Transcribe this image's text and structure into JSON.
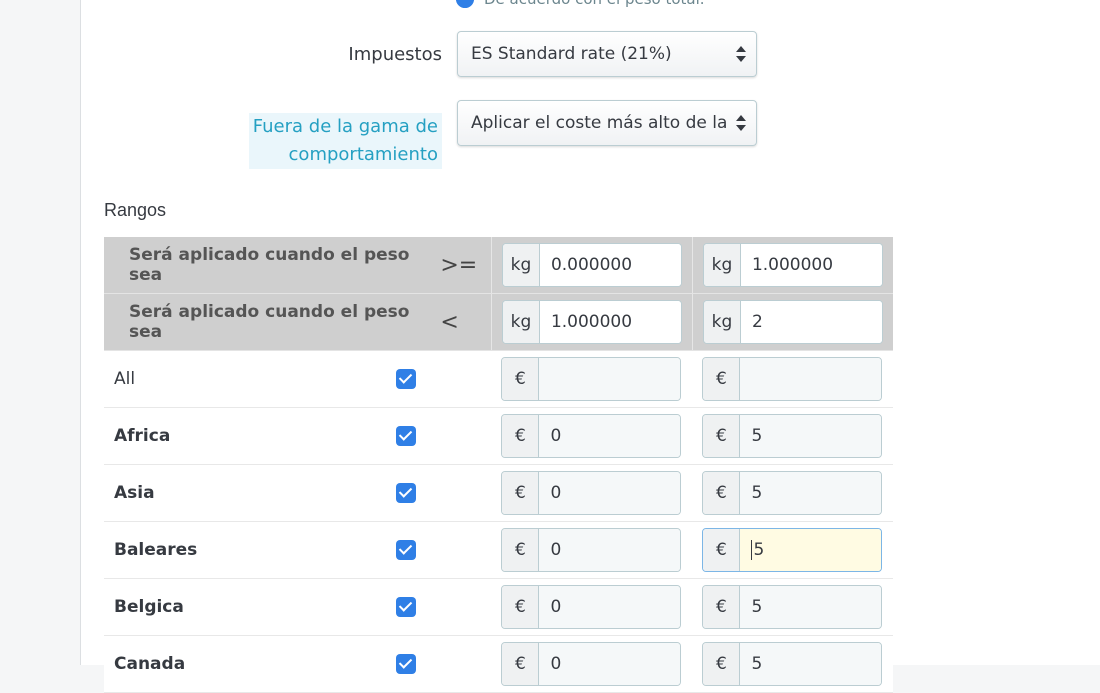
{
  "billing": {
    "option_label": "De acuerdo con el peso total."
  },
  "tax": {
    "label": "Impuestos",
    "selected": "ES Standard rate (21%)"
  },
  "out_of_range": {
    "label_line1": "Fuera de la gama de",
    "label_line2": "comportamiento",
    "selected": "Aplicar el coste más alto de la"
  },
  "ranges": {
    "title": "Rangos",
    "header_rows": [
      {
        "label": "Será aplicado cuando el peso sea",
        "operator": ">=",
        "unit": "kg",
        "values": [
          "0.000000",
          "1.000000"
        ]
      },
      {
        "label": "Será aplicado cuando el peso sea",
        "operator": "<",
        "unit": "kg",
        "values": [
          "1.000000",
          "2"
        ]
      }
    ],
    "currency": "€",
    "zones": [
      {
        "name": "All",
        "bold": false,
        "checked": true,
        "values": [
          "",
          ""
        ]
      },
      {
        "name": "Africa",
        "bold": true,
        "checked": true,
        "values": [
          "0",
          "5"
        ]
      },
      {
        "name": "Asia",
        "bold": true,
        "checked": true,
        "values": [
          "0",
          "5"
        ]
      },
      {
        "name": "Baleares",
        "bold": true,
        "checked": true,
        "values": [
          "0",
          "5"
        ]
      },
      {
        "name": "Belgica",
        "bold": true,
        "checked": true,
        "values": [
          "0",
          "5"
        ]
      },
      {
        "name": "Canada",
        "bold": true,
        "checked": true,
        "values": [
          "0",
          "5"
        ]
      }
    ]
  },
  "colors": {
    "accent": "#2f7fe6",
    "link": "#25a0c2",
    "header_bg": "#cfcfcf"
  }
}
